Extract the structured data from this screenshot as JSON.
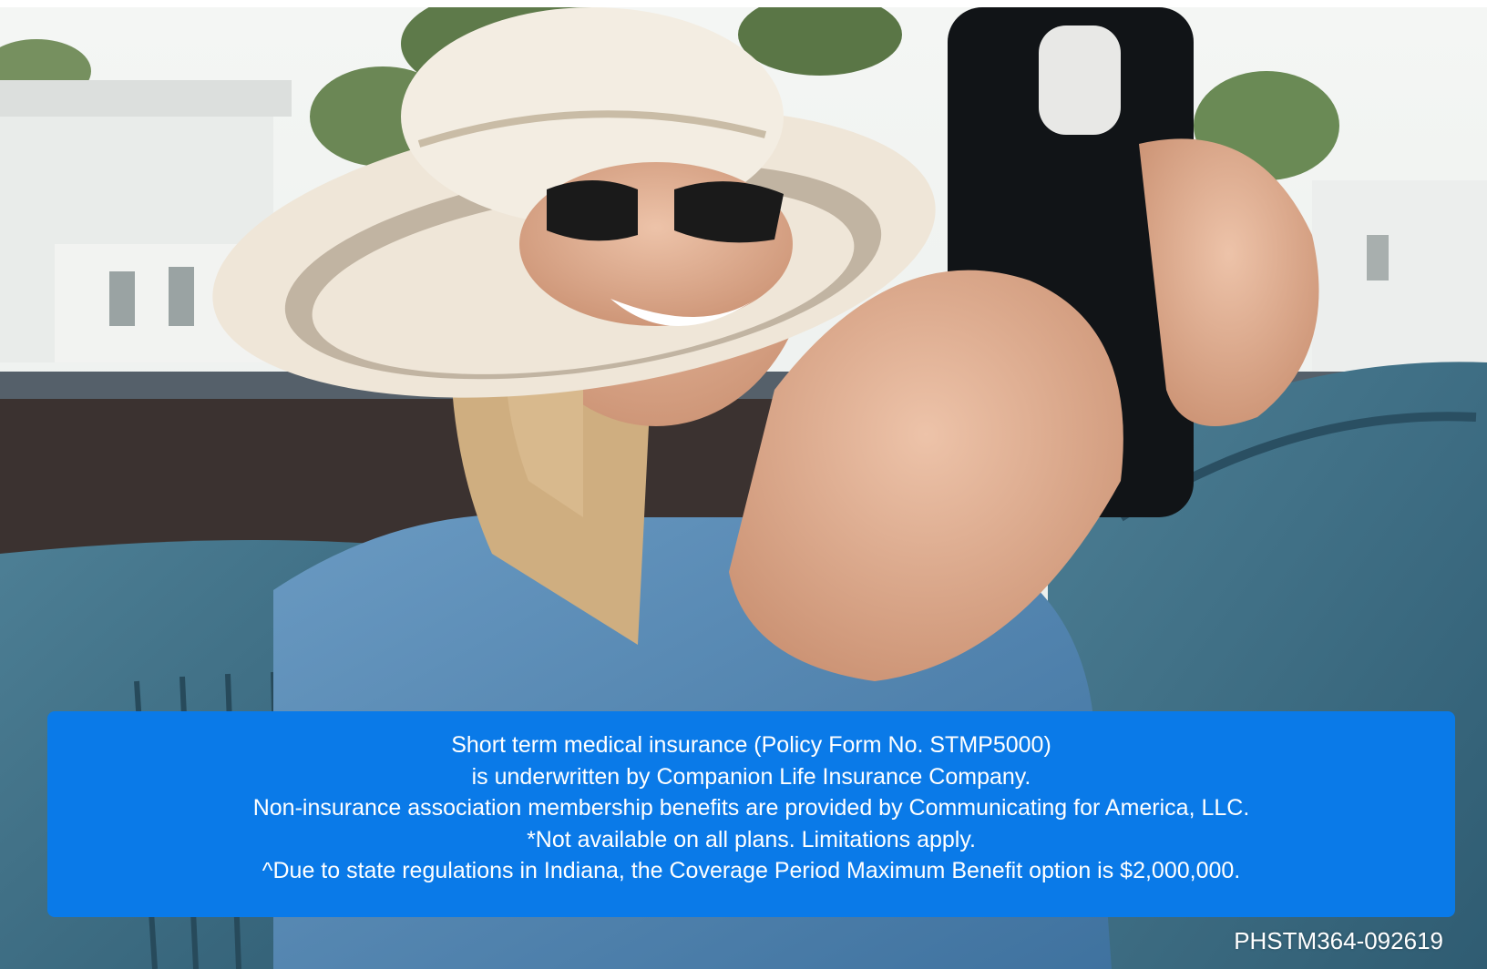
{
  "hero_image": {
    "subject": "woman-in-sunhat-with-phone",
    "colors": {
      "sky": "#eef1ef",
      "seat": "#3f6f85",
      "shirt": "#5b8db7",
      "hat": "#efe6d8",
      "hat_stripe": "#9a8b76",
      "phone": "#111417",
      "skin": "#d8a88c",
      "hair": "#d7b88d"
    }
  },
  "disclaimer": {
    "background": "#0a7ae8",
    "lines": [
      "Short term medical insurance (Policy Form No. STMP5000)",
      "is underwritten by Companion Life Insurance Company.",
      "Non-insurance association membership benefits are provided by Communicating for America, LLC.",
      "*Not available on all plans. Limitations apply.",
      "^Due to state regulations in Indiana, the Coverage Period Maximum Benefit option is $2,000,000."
    ]
  },
  "form_code": "PHSTM364-092619"
}
